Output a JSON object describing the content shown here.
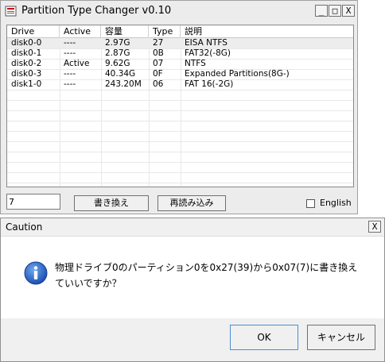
{
  "main_window": {
    "title": "Partition Type Changer v0.10",
    "minimize_label": "_",
    "maximize_label": "□",
    "close_label": "X",
    "columns": [
      "Drive",
      "Active",
      "容量",
      "Type",
      "説明"
    ],
    "rows": [
      {
        "drive": "disk0-0",
        "active": "----",
        "size": "2.97G",
        "type": "27",
        "desc": "EISA NTFS"
      },
      {
        "drive": "disk0-1",
        "active": "----",
        "size": "2.87G",
        "type": "0B",
        "desc": "FAT32(-8G)"
      },
      {
        "drive": "disk0-2",
        "active": "Active",
        "size": "9.62G",
        "type": "07",
        "desc": "NTFS"
      },
      {
        "drive": "disk0-3",
        "active": "----",
        "size": "40.34G",
        "type": "0F",
        "desc": "Expanded Partitions(8G-)"
      },
      {
        "drive": "disk1-0",
        "active": "----",
        "size": "243.20M",
        "type": "06",
        "desc": "FAT 16(-2G)"
      }
    ],
    "type_input_value": "7",
    "rewrite_button": "書き換え",
    "reload_button": "再読み込み",
    "english_checkbox_label": "English",
    "english_checked": false
  },
  "caution_dialog": {
    "title": "Caution",
    "close_label": "X",
    "message_line1": "物理ドライブ0のパーティション0を0x27(39)から0x07(7)に書き換え",
    "message_line2": "ていいですか？",
    "ok_button": "OK",
    "cancel_button": "キャンセル",
    "icon": "info-icon"
  }
}
